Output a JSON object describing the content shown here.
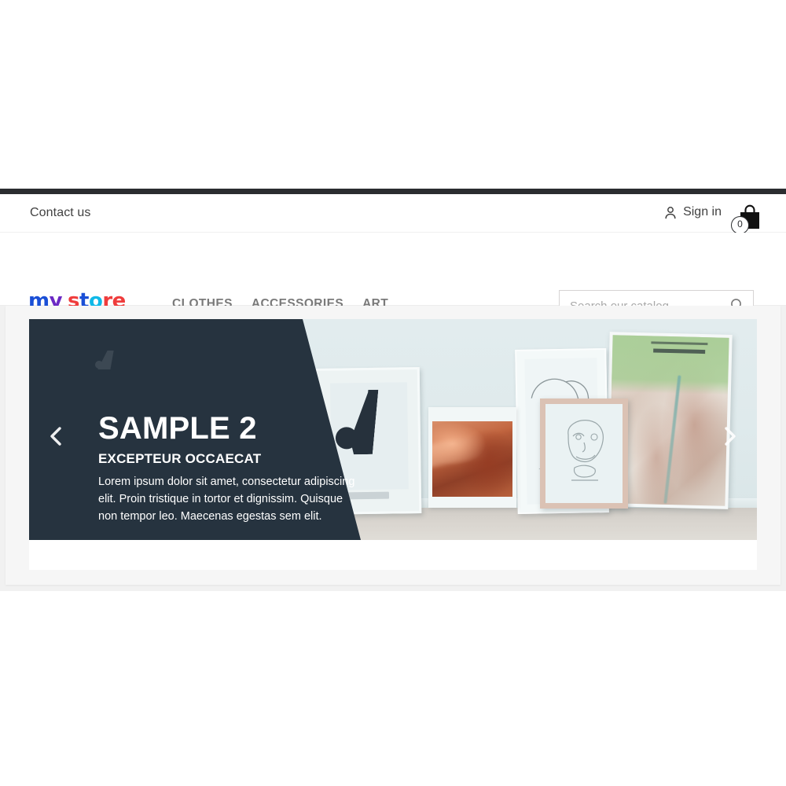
{
  "colors": {
    "dark_bar": "#2b2d30",
    "overlay": "#26333f",
    "text_grey": "#414141",
    "menu_grey": "#7a7a7a",
    "page_bg": "#f1f1f1",
    "logo_blue": "#1a4fd6",
    "logo_purple": "#6b29c4",
    "logo_cyan": "#0fb9e8",
    "logo_red": "#ef3c3c"
  },
  "header": {
    "contact_label": "Contact us",
    "signin_label": "Sign in",
    "user_icon": "user-icon",
    "cart_icon": "shopping-bag-icon",
    "cart_count": "0"
  },
  "logo": {
    "parts": [
      {
        "text": "m",
        "color": "#1a4fd6"
      },
      {
        "text": "y",
        "color": "#6b29c4"
      },
      {
        "text": "s",
        "color": "#ef3c3c"
      },
      {
        "text": "t",
        "color": "#1a4fd6"
      },
      {
        "text": "o",
        "color": "#0fb9e8"
      },
      {
        "text": "r",
        "color": "#ef3c3c"
      },
      {
        "text": "e",
        "color": "#ef3c3c"
      }
    ],
    "alt": "my store"
  },
  "menu": {
    "items": [
      {
        "label": "CLOTHES"
      },
      {
        "label": "ACCESSORIES"
      },
      {
        "label": "ART"
      }
    ]
  },
  "search": {
    "placeholder": "Search our catalog",
    "value": "",
    "icon": "search-icon"
  },
  "carousel": {
    "slide": {
      "title": "SAMPLE 2",
      "subtitle": "EXCEPTEUR OCCAECAT",
      "body": "Lorem ipsum dolor sit amet, consectetur adipiscing elit. Proin tristique in tortor et dignissim. Quisque non tempor leo. Maecenas egestas sem elit."
    },
    "prev_icon": "chevron-left-icon",
    "next_icon": "chevron-right-icon",
    "watermark_icon": "brand-watermark-icon"
  }
}
